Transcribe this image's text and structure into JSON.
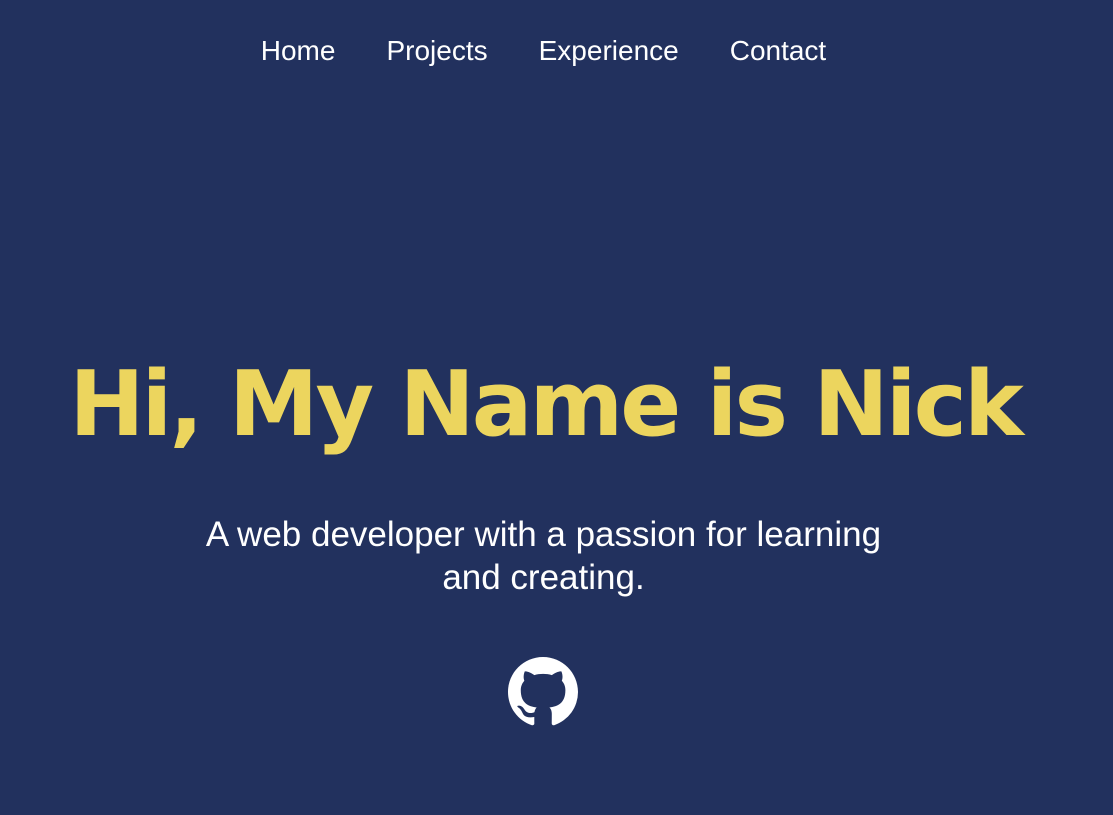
{
  "nav": {
    "items": [
      {
        "label": "Home"
      },
      {
        "label": "Projects"
      },
      {
        "label": "Experience"
      },
      {
        "label": "Contact"
      }
    ]
  },
  "hero": {
    "title": "Hi, My Name is Nick",
    "tagline": "A web developer with a passion for learning and creating."
  },
  "social": {
    "icon": "github-icon"
  },
  "colors": {
    "background": "#22315e",
    "accent": "#ecd55e",
    "text": "#ffffff"
  }
}
